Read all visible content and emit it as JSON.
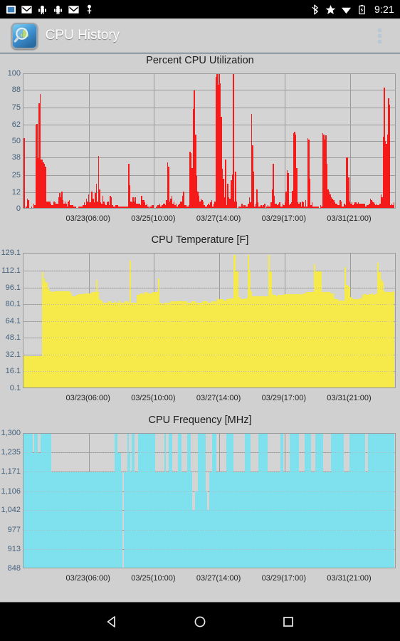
{
  "statusbar": {
    "time": "9:21",
    "left_icons": [
      "screenshot-icon",
      "gmail-icon",
      "android-icon",
      "android-icon",
      "gmail-icon",
      "usb-icon"
    ],
    "right_icons": [
      "bluetooth-icon",
      "star-icon",
      "wifi-icon",
      "battery-charging-icon"
    ]
  },
  "actionbar": {
    "back_glyph": "‹",
    "app_icon": "cpu-history-app-icon",
    "title": "CPU History",
    "overflow": "overflow-menu"
  },
  "navbar": {
    "back": "back-triangle-icon",
    "home": "home-circle-icon",
    "recents": "recents-square-icon"
  },
  "chart_data": [
    {
      "type": "bar",
      "title": "Percent CPU Utilization",
      "xlabel": "",
      "ylabel": "",
      "ylim": [
        0,
        100
      ],
      "grid": true,
      "color": "#f51b1b",
      "yticks": [
        "0",
        "12",
        "25",
        "38",
        "50",
        "62",
        "75",
        "88",
        "100"
      ],
      "ytick_values": [
        0,
        12,
        25,
        38,
        50,
        62,
        75,
        88,
        100
      ],
      "xticks": [
        "03/23(06:00)",
        "03/25(10:00)",
        "03/27(14:00)",
        "03/29(17:00)",
        "03/31(21:00)"
      ],
      "xtick_positions": [
        0.175,
        0.35,
        0.525,
        0.7,
        0.875
      ],
      "values": [
        52,
        0,
        1,
        7,
        6,
        0,
        0,
        1,
        0,
        3,
        2,
        62,
        63,
        37,
        78,
        85,
        36,
        36,
        34,
        33,
        31,
        5,
        5,
        5,
        5,
        3,
        2,
        2,
        5,
        4,
        3,
        3,
        8,
        11,
        8,
        12,
        6,
        3,
        5,
        3,
        1,
        5,
        6,
        2,
        2,
        2,
        1,
        1,
        1,
        0,
        0,
        1,
        1,
        1,
        1,
        2,
        4,
        2,
        7,
        5,
        10,
        4,
        4,
        12,
        7,
        4,
        11,
        18,
        5,
        39,
        14,
        4,
        3,
        9,
        5,
        3,
        2,
        4,
        5,
        2,
        9,
        8,
        2,
        1,
        1,
        2,
        2,
        2,
        1,
        1,
        1,
        1,
        1,
        1,
        1,
        1,
        1,
        33,
        17,
        5,
        4,
        8,
        5,
        8,
        3,
        3,
        3,
        3,
        2,
        9,
        6,
        6,
        4,
        2,
        3,
        1,
        0,
        1,
        1,
        2,
        2,
        0,
        0,
        1,
        2,
        2,
        3,
        1,
        2,
        3,
        3,
        2,
        6,
        34,
        31,
        5,
        7,
        9,
        3,
        5,
        2,
        3,
        1,
        2,
        3,
        5,
        5,
        9,
        12,
        2,
        2,
        1,
        1,
        2,
        42,
        41,
        30,
        74,
        88,
        55,
        24,
        12,
        9,
        5,
        7,
        6,
        5,
        2,
        1,
        1,
        2,
        3,
        2,
        4,
        6,
        1,
        3,
        5,
        98,
        100,
        92,
        100,
        93,
        68,
        29,
        22,
        8,
        36,
        2,
        18,
        8,
        7,
        21,
        25,
        100,
        5,
        27,
        5,
        0,
        1,
        1,
        1,
        3,
        1,
        2,
        2,
        1,
        1,
        3,
        8,
        4,
        70,
        47,
        27,
        1,
        3,
        14,
        4,
        1,
        1,
        2,
        1,
        2,
        3,
        0,
        1,
        2,
        1,
        1,
        4,
        14,
        33,
        9,
        3,
        3,
        2,
        3,
        4,
        1,
        1,
        3,
        2,
        4,
        12,
        28,
        26,
        2,
        3,
        4,
        13,
        56,
        57,
        55,
        30,
        4,
        3,
        4,
        1,
        5,
        4,
        1,
        6,
        1,
        52,
        51,
        22,
        2,
        4,
        1,
        1,
        1,
        1,
        1,
        1,
        0,
        2,
        1,
        56,
        55,
        51,
        54,
        33,
        14,
        12,
        10,
        8,
        7,
        6,
        4,
        3,
        3,
        2,
        2,
        6,
        5,
        1,
        1,
        3,
        2,
        38,
        38,
        23,
        5,
        3,
        4,
        2,
        3,
        4,
        4,
        3,
        4,
        3,
        3,
        3,
        3,
        3,
        3,
        1,
        2,
        2,
        3,
        7,
        6,
        5,
        4,
        3,
        2,
        3,
        2,
        2,
        3,
        10,
        8,
        53,
        90,
        50,
        48,
        55,
        82,
        77,
        2,
        3,
        2,
        4
      ]
    },
    {
      "type": "bar",
      "title": "CPU Temperature [F]",
      "xlabel": "",
      "ylabel": "",
      "ylim": [
        0.1,
        129.1
      ],
      "grid": true,
      "color": "#f5ea4a",
      "yticks": [
        "0.1",
        "16.1",
        "32.1",
        "48.1",
        "64.1",
        "80.1",
        "96.1",
        "112.1",
        "129.1"
      ],
      "ytick_values": [
        0.1,
        16.1,
        32.1,
        48.1,
        64.1,
        80.1,
        96.1,
        112.1,
        129.1
      ],
      "xticks": [
        "03/23(06:00)",
        "03/25(10:00)",
        "03/27(14:00)",
        "03/29(17:00)",
        "03/31(21:00)"
      ],
      "xtick_positions": [
        0.175,
        0.35,
        0.525,
        0.7,
        0.875
      ],
      "values": [
        31,
        30,
        30,
        30,
        30,
        30,
        30,
        30,
        30,
        30,
        30,
        30,
        111,
        105,
        102,
        101,
        96,
        93,
        93,
        92,
        93,
        93,
        93,
        93,
        93,
        93,
        93,
        93,
        93,
        93,
        93,
        91,
        88,
        88,
        88,
        89,
        90,
        90,
        90,
        90,
        91,
        91,
        91,
        91,
        91,
        92,
        92,
        92,
        104,
        92,
        85,
        84,
        82,
        82,
        82,
        82,
        83,
        83,
        82,
        82,
        83,
        82,
        82,
        84,
        82,
        82,
        82,
        83,
        83,
        82,
        122,
        82,
        82,
        82,
        82,
        89,
        90,
        91,
        91,
        90,
        92,
        92,
        91,
        91,
        91,
        92,
        92,
        92,
        92,
        105,
        82,
        81,
        81,
        82,
        82,
        82,
        82,
        83,
        83,
        83,
        83,
        83,
        83,
        84,
        83,
        83,
        83,
        83,
        82,
        82,
        82,
        83,
        83,
        83,
        82,
        82,
        82,
        82,
        83,
        83,
        83,
        83,
        82,
        82,
        83,
        83,
        83,
        83,
        86,
        85,
        85,
        85,
        84,
        84,
        85,
        85,
        86,
        86,
        86,
        128,
        112,
        112,
        87,
        86,
        85,
        85,
        86,
        86,
        128,
        113,
        93,
        88,
        88,
        88,
        88,
        88,
        88,
        88,
        88,
        88,
        88,
        88,
        128,
        112,
        90,
        89,
        89,
        88,
        89,
        89,
        89,
        89,
        90,
        90,
        90,
        90,
        90,
        90,
        90,
        90,
        90,
        90,
        90,
        90,
        90,
        91,
        91,
        92,
        92,
        92,
        92,
        92,
        119,
        112,
        112,
        112,
        112,
        92,
        92,
        92,
        92,
        92,
        92,
        91,
        91,
        86,
        85,
        85,
        84,
        84,
        84,
        84,
        116,
        99,
        98,
        97,
        87,
        86,
        85,
        85,
        85,
        85,
        86,
        86,
        89,
        90,
        90,
        89,
        90,
        90,
        91,
        89,
        90,
        91,
        120,
        111,
        104,
        102,
        93,
        92,
        92,
        92,
        92,
        92,
        93
      ]
    },
    {
      "type": "bar",
      "title": "CPU Frequency [MHz]",
      "xlabel": "",
      "ylabel": "",
      "ylim": [
        848,
        1300
      ],
      "grid": true,
      "color": "#7fe0ee",
      "yticks": [
        "848",
        "913",
        "977",
        "1,042",
        "1,106",
        "1,171",
        "1,235",
        "1,300"
      ],
      "ytick_values": [
        848,
        913,
        977,
        1042,
        1106,
        1171,
        1235,
        1300
      ],
      "xticks": [
        "03/23(06:00)",
        "03/25(10:00)",
        "03/27(14:00)",
        "03/29(17:00)",
        "03/31(21:00)"
      ],
      "xtick_positions": [
        0.175,
        0.35,
        0.525,
        0.7,
        0.875
      ],
      "values": [
        1300,
        1300,
        1300,
        1300,
        1300,
        1300,
        1235,
        1300,
        1300,
        1235,
        1235,
        1300,
        1300,
        1300,
        1300,
        1300,
        1300,
        1300,
        1171,
        1171,
        1171,
        1171,
        1171,
        1171,
        1171,
        1171,
        1171,
        1171,
        1171,
        1171,
        1171,
        1171,
        1171,
        1171,
        1171,
        1171,
        1171,
        1171,
        1171,
        1171,
        1171,
        1171,
        1171,
        1171,
        1171,
        1171,
        1171,
        1171,
        1171,
        1171,
        1171,
        1171,
        1171,
        1171,
        1171,
        1171,
        1171,
        1171,
        1171,
        1300,
        1300,
        1235,
        1235,
        1171,
        848,
        1171,
        1171,
        1300,
        1235,
        1171,
        1300,
        1300,
        1171,
        1171,
        1300,
        1300,
        1300,
        1300,
        1300,
        1300,
        1300,
        1300,
        1300,
        1300,
        1300,
        1171,
        1171,
        1171,
        1171,
        1171,
        1171,
        1300,
        1171,
        1171,
        1300,
        1300,
        1171,
        1171,
        1171,
        1171,
        1300,
        1300,
        1171,
        1171,
        1171,
        1171,
        1300,
        1300,
        1171,
        1042,
        1042,
        1106,
        1106,
        1300,
        1300,
        1300,
        1300,
        1300,
        1106,
        1042,
        1171,
        1171,
        1300,
        1300,
        1300,
        1171,
        1171,
        1171,
        1171,
        1171,
        1171,
        1300,
        1300,
        1300,
        1300,
        1300,
        1171,
        1171,
        1171,
        1171,
        1171,
        1171,
        1171,
        1300,
        1300,
        1300,
        1300,
        1171,
        1171,
        1171,
        1171,
        1171,
        1300,
        1300,
        1300,
        1300,
        1300,
        1300,
        1171,
        1171,
        1171,
        1171,
        1171,
        1171,
        1171,
        1171,
        1300,
        1300,
        1171,
        1171,
        1171,
        1171,
        1300,
        1300,
        1300,
        1300,
        1300,
        1300,
        1171,
        1171,
        1171,
        1171,
        1300,
        1300,
        1300,
        1300,
        1171,
        1171,
        1171,
        1300,
        1300,
        1300,
        1300,
        1300,
        1171,
        1171,
        1171,
        1171,
        1171,
        1300,
        1300,
        1300,
        1300,
        1300,
        1300,
        1300,
        1300,
        1171,
        1171,
        1171,
        1171,
        1300,
        1300,
        1300,
        1300,
        1300,
        1300,
        1300,
        1300,
        1300,
        1300,
        1171,
        1171,
        1300,
        1300,
        1300,
        1300,
        1300,
        1300,
        1300,
        1300,
        1300,
        1300,
        1300,
        1300,
        1300,
        1300,
        1300,
        1300,
        1300
      ]
    }
  ]
}
